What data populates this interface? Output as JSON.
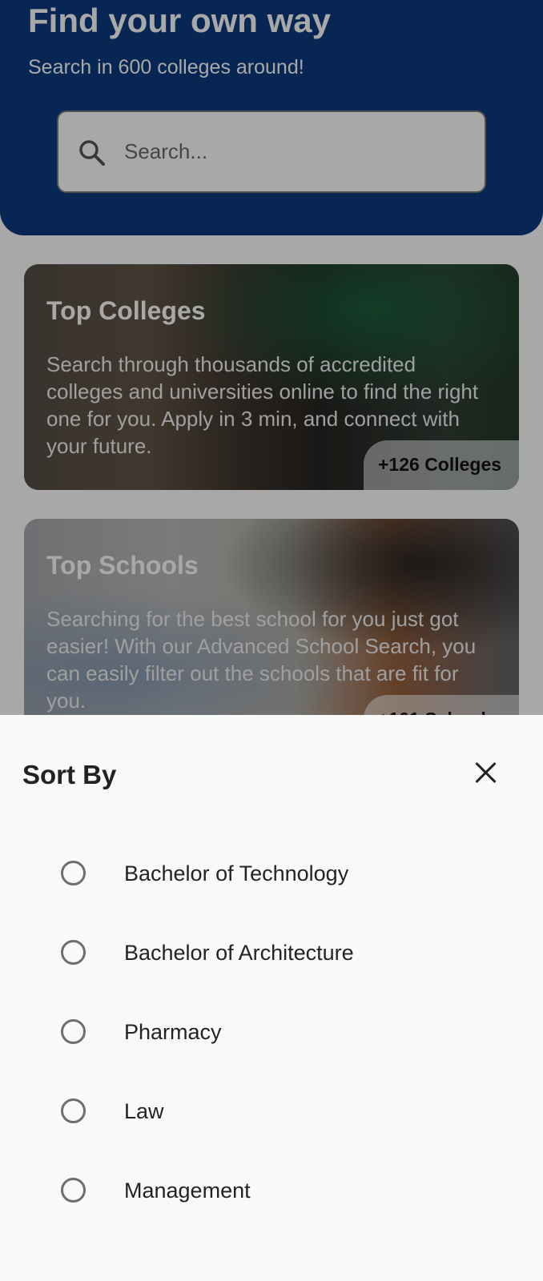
{
  "hero": {
    "title": "Find your own way",
    "subtitle": "Search in 600 colleges around!",
    "search_placeholder": "Search...",
    "background_color": "#0b3a80"
  },
  "cards": [
    {
      "title": "Top Colleges",
      "description": "Search through thousands of accredited colleges and universities online to find the right one for you.  Apply in 3 min, and connect with your future.",
      "badge": "+126 Colleges"
    },
    {
      "title": "Top Schools",
      "description": "Searching for the best school for you just got easier! With our Advanced School Search, you can easily filter out the schools that are fit for you.",
      "badge": "+101 Schools"
    }
  ],
  "sheet": {
    "title": "Sort By",
    "close_icon": "close-icon",
    "options": [
      {
        "label": "Bachelor of Technology",
        "selected": false
      },
      {
        "label": "Bachelor of Architecture",
        "selected": false
      },
      {
        "label": "Pharmacy",
        "selected": false
      },
      {
        "label": "Law",
        "selected": false
      },
      {
        "label": "Management",
        "selected": false
      }
    ]
  }
}
